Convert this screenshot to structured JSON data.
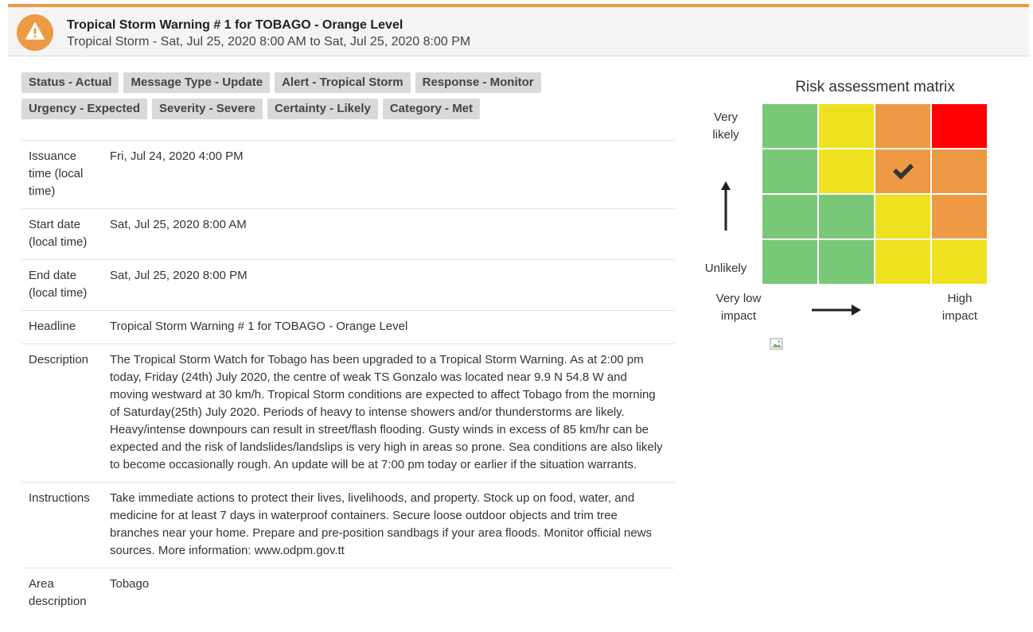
{
  "header": {
    "title": "Tropical Storm Warning # 1 for TOBAGO - Orange Level",
    "subtitle": "Tropical Storm - Sat, Jul 25, 2020 8:00 AM to Sat, Jul 25, 2020 8:00 PM",
    "icon": "warning-icon",
    "accent_color": "#ee9a45"
  },
  "tags": {
    "row1": [
      "Status - Actual",
      "Message Type - Update",
      "Alert - Tropical Storm",
      "Response - Monitor"
    ],
    "row2": [
      "Urgency - Expected",
      "Severity - Severe",
      "Certainty - Likely",
      "Category - Met"
    ]
  },
  "details": [
    {
      "label": "Issuance time (local time)",
      "value": "Fri, Jul 24, 2020 4:00 PM"
    },
    {
      "label": "Start date (local time)",
      "value": "Sat, Jul 25, 2020 8:00 AM"
    },
    {
      "label": "End date (local time)",
      "value": "Sat, Jul 25, 2020 8:00 PM"
    },
    {
      "label": "Headline",
      "value": "Tropical Storm Warning # 1 for TOBAGO - Orange Level"
    },
    {
      "label": "Description",
      "value": "The Tropical Storm Watch for Tobago has been upgraded to a Tropical Storm Warning. As at 2:00 pm today, Friday (24th) July 2020, the centre of weak TS Gonzalo was located near 9.9 N 54.8 W and moving westward at 30 km/h. Tropical Storm conditions are expected to affect Tobago from the morning of Saturday(25th) July 2020. Periods of heavy to intense showers and/or thunderstorms are likely. Heavy/intense downpours can result in street/flash flooding. Gusty winds in excess of 85 km/hr can be expected and the risk of landslides/landslips is very high in areas so prone. Sea conditions are also likely to become occasionally rough. An update will be at 7:00 pm today or earlier if the situation warrants."
    },
    {
      "label": "Instructions",
      "value": "Take immediate actions to protect their lives, livelihoods, and property. Stock up on food, water, and medicine for at least 7 days in waterproof containers. Secure loose outdoor objects and trim tree branches near your home. Prepare and pre-position sandbags if your area floods. Monitor official news sources. More information: www.odpm.gov.tt"
    },
    {
      "label": "Area description",
      "value": "Tobago"
    }
  ],
  "matrix": {
    "title": "Risk assessment matrix",
    "y_top": "Very likely",
    "y_bottom": "Unlikely",
    "x_left": "Very low impact",
    "x_right": "High impact",
    "colors": {
      "green": "#78c878",
      "yellow": "#eee21e",
      "orange": "#ee9a45",
      "red": "#ff0000"
    },
    "rows": [
      [
        "green",
        "yellow",
        "orange",
        "red"
      ],
      [
        "green",
        "yellow",
        "orange",
        "orange"
      ],
      [
        "green",
        "green",
        "yellow",
        "orange"
      ],
      [
        "green",
        "green",
        "yellow",
        "yellow"
      ]
    ],
    "selected": {
      "row": 1,
      "col": 2
    },
    "selected_icon": "checkmark-icon"
  }
}
